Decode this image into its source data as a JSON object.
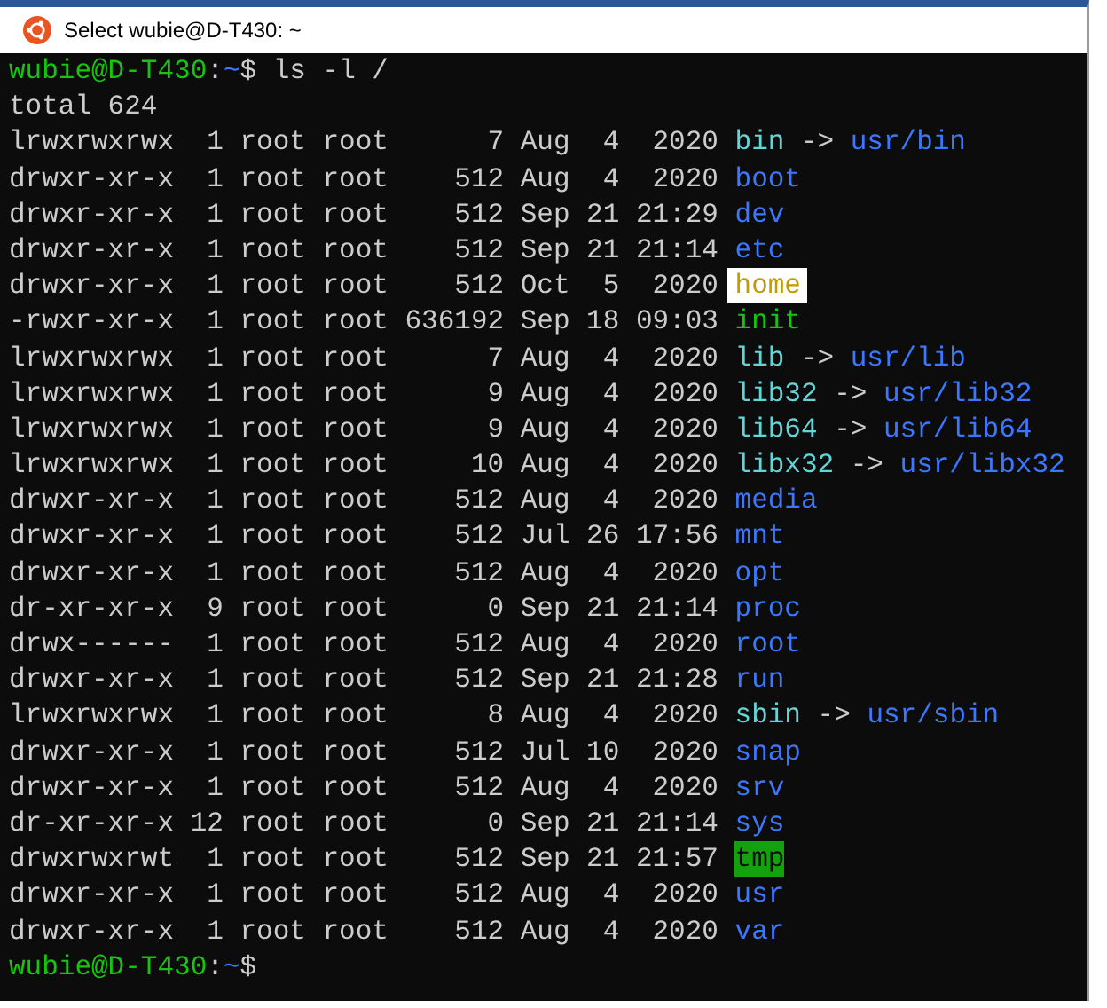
{
  "window": {
    "title": "Select wubie@D-T430: ~"
  },
  "prompt": {
    "user": "wubie@D-T430",
    "separator": ":",
    "path": "~",
    "symbol": "$",
    "command": "ls -l /"
  },
  "total": "total 624",
  "entries": [
    {
      "info": "lrwxrwxrwx  1 root root      7 Aug  4  2020",
      "name": "bin",
      "kind": "link",
      "arrow": "->",
      "target": "usr/bin",
      "selected": false
    },
    {
      "info": "drwxr-xr-x  1 root root    512 Aug  4  2020",
      "name": "boot",
      "kind": "dir",
      "selected": false
    },
    {
      "info": "drwxr-xr-x  1 root root    512 Sep 21 21:29",
      "name": "dev",
      "kind": "dir",
      "selected": false
    },
    {
      "info": "drwxr-xr-x  1 root root    512 Sep 21 21:14",
      "name": "etc",
      "kind": "dir",
      "selected": false
    },
    {
      "info": "drwxr-xr-x  1 root root    512 Oct  5  2020",
      "name": "home",
      "kind": "dir",
      "selected": true
    },
    {
      "info": "-rwxr-xr-x  1 root root 636192 Sep 18 09:03",
      "name": "init",
      "kind": "exec",
      "selected": false
    },
    {
      "info": "lrwxrwxrwx  1 root root      7 Aug  4  2020",
      "name": "lib",
      "kind": "link",
      "arrow": "->",
      "target": "usr/lib",
      "selected": false
    },
    {
      "info": "lrwxrwxrwx  1 root root      9 Aug  4  2020",
      "name": "lib32",
      "kind": "link",
      "arrow": "->",
      "target": "usr/lib32",
      "selected": false
    },
    {
      "info": "lrwxrwxrwx  1 root root      9 Aug  4  2020",
      "name": "lib64",
      "kind": "link",
      "arrow": "->",
      "target": "usr/lib64",
      "selected": false
    },
    {
      "info": "lrwxrwxrwx  1 root root     10 Aug  4  2020",
      "name": "libx32",
      "kind": "link",
      "arrow": "->",
      "target": "usr/libx32",
      "selected": false
    },
    {
      "info": "drwxr-xr-x  1 root root    512 Aug  4  2020",
      "name": "media",
      "kind": "dir",
      "selected": false
    },
    {
      "info": "drwxr-xr-x  1 root root    512 Jul 26 17:56",
      "name": "mnt",
      "kind": "dir",
      "selected": false
    },
    {
      "info": "drwxr-xr-x  1 root root    512 Aug  4  2020",
      "name": "opt",
      "kind": "dir",
      "selected": false
    },
    {
      "info": "dr-xr-xr-x  9 root root      0 Sep 21 21:14",
      "name": "proc",
      "kind": "dir",
      "selected": false
    },
    {
      "info": "drwx------  1 root root    512 Aug  4  2020",
      "name": "root",
      "kind": "dir",
      "selected": false
    },
    {
      "info": "drwxr-xr-x  1 root root    512 Sep 21 21:28",
      "name": "run",
      "kind": "dir",
      "selected": false
    },
    {
      "info": "lrwxrwxrwx  1 root root      8 Aug  4  2020",
      "name": "sbin",
      "kind": "link",
      "arrow": "->",
      "target": "usr/sbin",
      "selected": false
    },
    {
      "info": "drwxr-xr-x  1 root root    512 Jul 10  2020",
      "name": "snap",
      "kind": "dir",
      "selected": false
    },
    {
      "info": "drwxr-xr-x  1 root root    512 Aug  4  2020",
      "name": "srv",
      "kind": "dir",
      "selected": false
    },
    {
      "info": "dr-xr-xr-x 12 root root      0 Sep 21 21:14",
      "name": "sys",
      "kind": "dir",
      "selected": false
    },
    {
      "info": "drwxrwxrwt  1 root root    512 Sep 21 21:57",
      "name": "tmp",
      "kind": "sticky",
      "selected": false
    },
    {
      "info": "drwxr-xr-x  1 root root    512 Aug  4  2020",
      "name": "usr",
      "kind": "dir",
      "selected": false
    },
    {
      "info": "drwxr-xr-x  1 root root    512 Aug  4  2020",
      "name": "var",
      "kind": "dir",
      "selected": false
    }
  ],
  "final_prompt": {
    "user": "wubie@D-T430",
    "separator": ":",
    "path": "~",
    "symbol": "$"
  }
}
